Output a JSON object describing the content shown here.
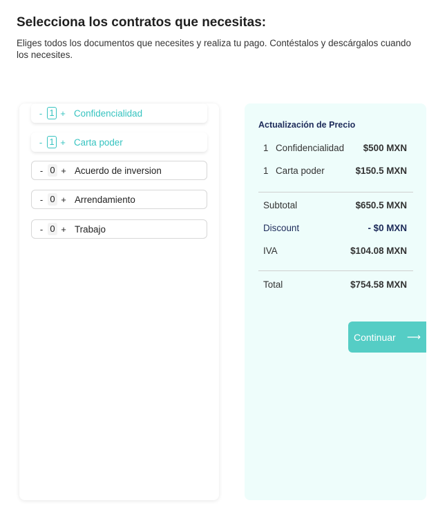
{
  "header": {
    "title": "Selecciona los contratos que necesitas:",
    "subtitle": "Eliges todos los documentos que necesites y realiza tu pago. Contéstalos y descárgalos cuando los necesites."
  },
  "contracts": [
    {
      "minus": "-",
      "qty": "1",
      "plus": "+",
      "label": "Confidencialidad",
      "selected": true
    },
    {
      "minus": "-",
      "qty": "1",
      "plus": "+",
      "label": "Carta poder",
      "selected": true
    },
    {
      "minus": "-",
      "qty": "0",
      "plus": "+",
      "label": "Acuerdo de inversion",
      "selected": false
    },
    {
      "minus": "-",
      "qty": "0",
      "plus": "+",
      "label": "Arrendamiento",
      "selected": false
    },
    {
      "minus": "-",
      "qty": "0",
      "plus": "+",
      "label": "Trabajo",
      "selected": false
    }
  ],
  "summary": {
    "title": "Actualización de Precio",
    "lines": [
      {
        "qty": "1",
        "name": "Confidencialidad",
        "amount": "$500 MXN"
      },
      {
        "qty": "1",
        "name": "Carta poder",
        "amount": "$150.5 MXN"
      }
    ],
    "subtotal_label": "Subtotal",
    "subtotal": "$650.5 MXN",
    "discount_label": "Discount",
    "discount": "- $0 MXN",
    "iva_label": "IVA",
    "iva": "$104.08 MXN",
    "total_label": "Total",
    "total": "$754.58 MXN"
  },
  "actions": {
    "continue_label": "Continuar",
    "arrow": "⟶"
  },
  "colors": {
    "accent": "#36c3c0",
    "button": "#55cdc5",
    "summary_bg": "#eefdfb",
    "navy": "#1d2b5a"
  }
}
